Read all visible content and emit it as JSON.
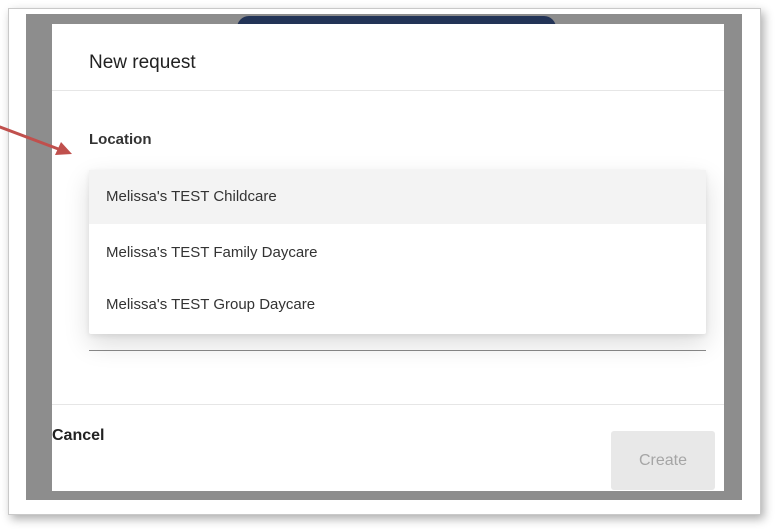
{
  "modal": {
    "title": "New request",
    "location_label": "Location",
    "location_options": [
      {
        "label": "Melissa's TEST Childcare",
        "highlighted": true
      },
      {
        "label": "Melissa's TEST Family Daycare",
        "highlighted": false
      },
      {
        "label": "Melissa's TEST Group Daycare",
        "highlighted": false
      }
    ],
    "cancel_label": "Cancel",
    "create_label": "Create",
    "create_enabled": false
  },
  "annotation": {
    "arrow_color": "#c0504d"
  },
  "colors": {
    "backdrop": "#8d8d8d",
    "navbar_peek": "#233457",
    "option_highlight": "#f3f3f3",
    "disabled_button_bg": "#e8e8e8",
    "disabled_button_text": "#a5a5a5"
  }
}
